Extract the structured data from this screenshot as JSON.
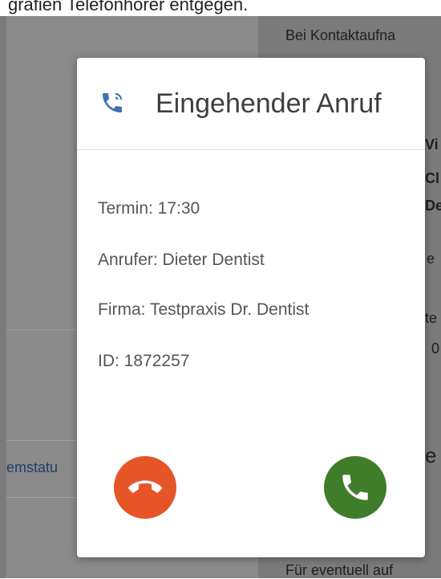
{
  "background": {
    "top_text": "grafien Telefonhörer entgegen.",
    "left_text": "emstatu",
    "right_lines": [
      {
        "text": "Bei Kontaktaufna"
      },
      {
        "text": "Vi"
      },
      {
        "text": "Cl"
      },
      {
        "text": "De"
      },
      {
        "text": "e"
      },
      {
        "text": "te"
      },
      {
        "text": "0"
      },
      {
        "text": "e"
      },
      {
        "text": "Für eventuell auf"
      }
    ]
  },
  "dialog": {
    "title": "Eingehender Anruf",
    "lines": [
      {
        "text": "Termin: 17:30"
      },
      {
        "text": "Anrufer: Dieter Dentist"
      },
      {
        "text": "Firma: Testpraxis Dr. Dentist"
      },
      {
        "text": "ID: 1872257"
      }
    ],
    "icons": {
      "header": "phone-in-talk-icon",
      "decline": "call-end-icon",
      "accept": "phone-icon"
    },
    "colors": {
      "header_icon": "#3f73b3",
      "decline": "#e65527",
      "accept": "#3f7d2b"
    }
  }
}
